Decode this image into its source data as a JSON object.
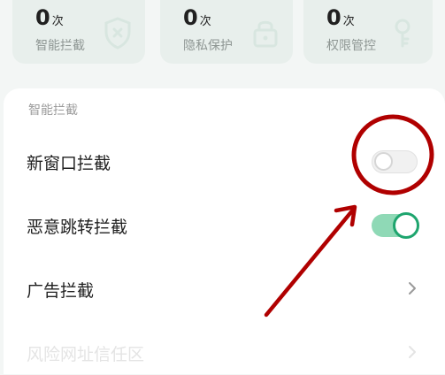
{
  "stats": [
    {
      "value": "0",
      "unit": "次",
      "label": "智能拦截",
      "icon": "shield-icon"
    },
    {
      "value": "0",
      "unit": "次",
      "label": "隐私保护",
      "icon": "lock-icon"
    },
    {
      "value": "0",
      "unit": "次",
      "label": "权限管控",
      "icon": "key-icon"
    }
  ],
  "section": {
    "title": "智能拦截"
  },
  "settings": [
    {
      "label": "新窗口拦截",
      "control": "toggle",
      "state": "off"
    },
    {
      "label": "恶意跳转拦截",
      "control": "toggle",
      "state": "on"
    },
    {
      "label": "广告拦截",
      "control": "chevron"
    },
    {
      "label": "风险网址信任区",
      "control": "chevron"
    }
  ],
  "colors": {
    "accent": "#1ea56e",
    "annotation": "#b00000"
  }
}
